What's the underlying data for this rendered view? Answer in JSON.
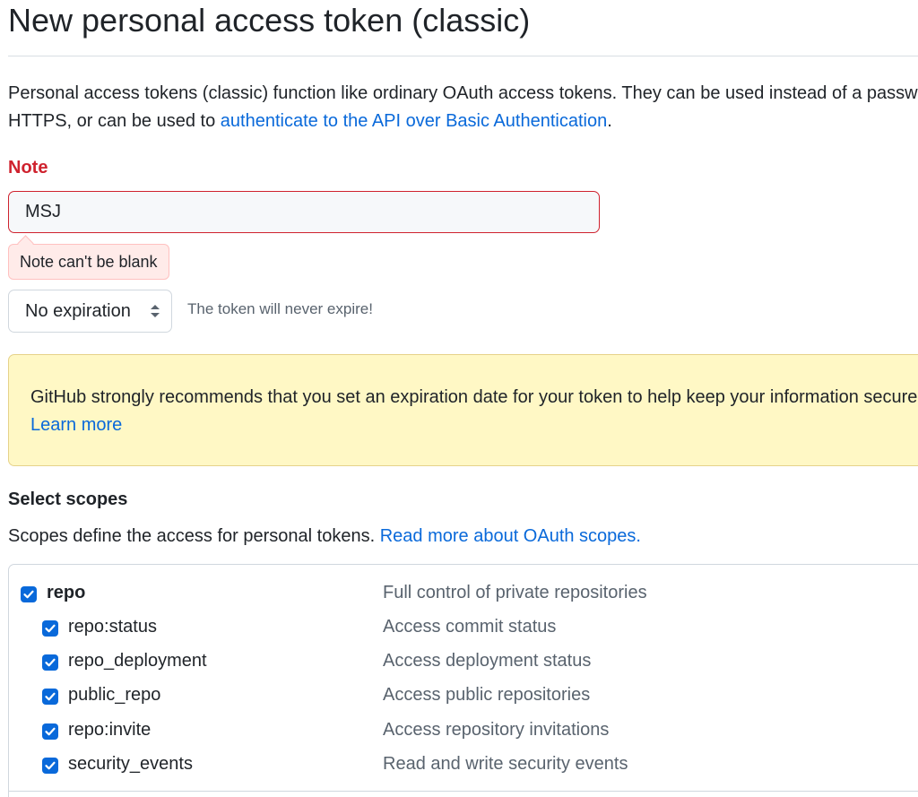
{
  "page": {
    "title": "New personal access token (classic)",
    "intro_text": "Personal access tokens (classic) function like ordinary OAuth access tokens. They can be used instead of a password for Git over HTTPS, or can be used to",
    "intro_link": "authenticate to the API over Basic Authentication",
    "intro_end": "."
  },
  "note": {
    "label": "Note",
    "value": "MSJ",
    "error": "Note can't be blank"
  },
  "expiration": {
    "selected": "No expiration",
    "hint": "The token will never expire!"
  },
  "warning": {
    "text": "GitHub strongly recommends that you set an expiration date for your token to help keep your information secure.",
    "link": "Learn more"
  },
  "scopes": {
    "heading": "Select scopes",
    "description": "Scopes define the access for personal tokens.",
    "link": "Read more about OAuth scopes.",
    "items": [
      {
        "name": "repo",
        "description": "Full control of private repositories",
        "checked": true
      },
      {
        "name": "repo:status",
        "description": "Access commit status",
        "checked": true
      },
      {
        "name": "repo_deployment",
        "description": "Access deployment status",
        "checked": true
      },
      {
        "name": "public_repo",
        "description": "Access public repositories",
        "checked": true
      },
      {
        "name": "repo:invite",
        "description": "Access repository invitations",
        "checked": true
      },
      {
        "name": "security_events",
        "description": "Read and write security events",
        "checked": true
      }
    ]
  },
  "colors": {
    "accent": "#0969da",
    "danger": "#cf222e",
    "warning_bg": "#fff8c5"
  }
}
